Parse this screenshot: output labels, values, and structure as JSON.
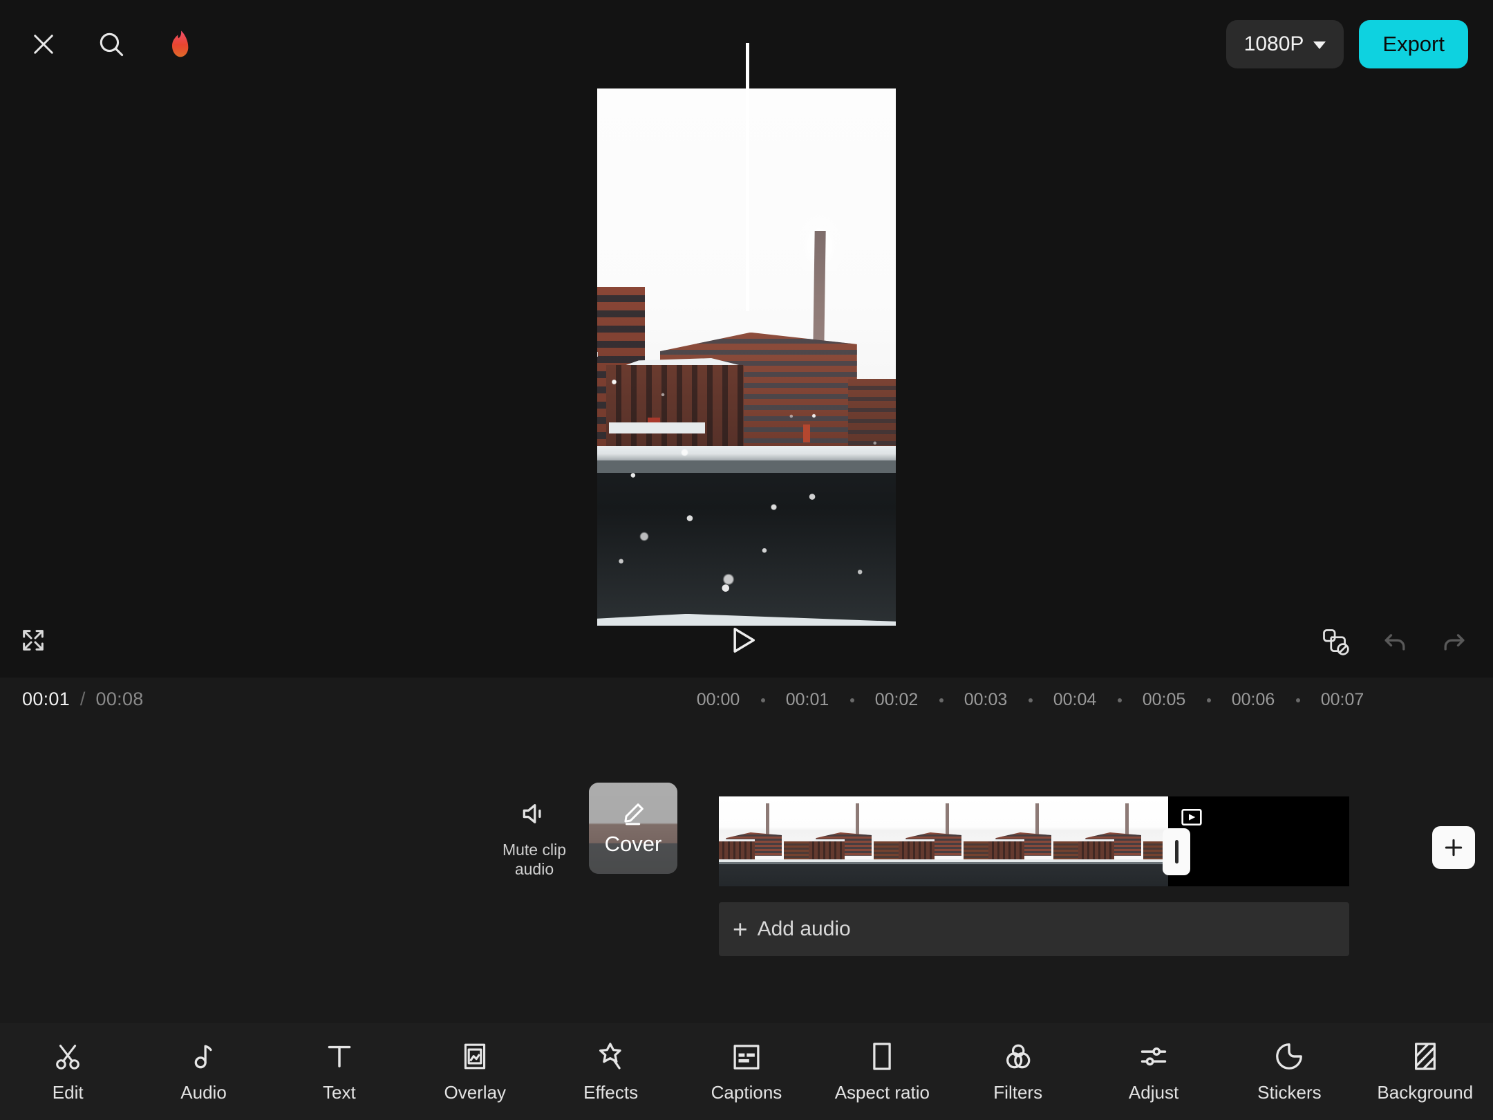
{
  "app": {
    "name": "video-editor",
    "accent_cyan": "#0ed2e0",
    "background": "#131313",
    "timeline_background": "#1a1a1a",
    "toolbar_background": "#1e1e1e"
  },
  "topbar": {
    "close_icon": "close-icon",
    "search_icon": "search-icon",
    "flame_icon": "flame-icon",
    "flame_color_top": "#f0506c",
    "flame_color_bottom": "#df5a2d",
    "resolution": "1080P",
    "resolution_caret": "chevron-down-icon",
    "export_label": "Export"
  },
  "preview": {
    "fullscreen_icon": "fullscreen-icon",
    "play_icon": "play-icon",
    "watermark_icon": "remove-watermark-icon",
    "undo_icon": "undo-icon",
    "redo_icon": "redo-icon"
  },
  "timeline": {
    "current_time": "00:01",
    "separator": "/",
    "total_time": "00:08",
    "ruler_labels": [
      "00:00",
      "00:01",
      "00:02",
      "00:03",
      "00:04",
      "00:05",
      "00:06",
      "00:07"
    ],
    "mute": {
      "icon": "speaker-mute-icon",
      "label_line1": "Mute clip",
      "label_line2": "audio"
    },
    "cover": {
      "icon": "pencil-edit-icon",
      "label": "Cover"
    },
    "clip": {
      "badge_icon": "video-clip-icon",
      "trim_handle": "right-trim-handle",
      "thumbnail_count": 5
    },
    "audio_row": {
      "plus": "+",
      "label": "Add audio"
    },
    "add_clip_button": {
      "icon": "plus-icon"
    }
  },
  "toolbar": {
    "items": [
      {
        "label": "Edit",
        "icon": "scissors-icon"
      },
      {
        "label": "Audio",
        "icon": "music-note-icon"
      },
      {
        "label": "Text",
        "icon": "text-t-icon"
      },
      {
        "label": "Overlay",
        "icon": "image-frame-icon"
      },
      {
        "label": "Effects",
        "icon": "sparkle-star-icon"
      },
      {
        "label": "Captions",
        "icon": "captions-box-icon"
      },
      {
        "label": "Aspect ratio",
        "icon": "rectangle-icon"
      },
      {
        "label": "Filters",
        "icon": "filters-circles-icon"
      },
      {
        "label": "Adjust",
        "icon": "sliders-icon"
      },
      {
        "label": "Stickers",
        "icon": "sticker-peel-icon"
      },
      {
        "label": "Background",
        "icon": "diagonal-stripes-icon"
      }
    ]
  }
}
